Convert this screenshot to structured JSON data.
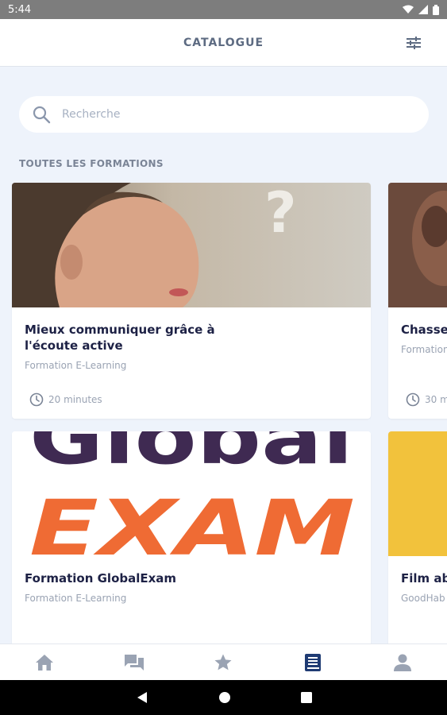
{
  "status_bar": {
    "time": "5:44"
  },
  "header": {
    "title": "CATALOGUE",
    "filter_icon": "tune-icon"
  },
  "search": {
    "placeholder": "Recherche",
    "value": ""
  },
  "section": {
    "title": "TOUTES LES FORMATIONS"
  },
  "courses": [
    {
      "title": "Mieux communiquer grâce à\nl'écoute active",
      "subtitle": "Formation E-Learning",
      "duration": "20 minutes"
    },
    {
      "title": "Chasse",
      "subtitle": "Formation",
      "duration": "30 m"
    },
    {
      "title": "Formation GlobalExam",
      "subtitle": "Formation E-Learning",
      "image_text": [
        "Global",
        "EXAM"
      ]
    },
    {
      "title": "Film ab",
      "subtitle": "GoodHab"
    }
  ],
  "bottom_nav": [
    {
      "name": "home",
      "icon": "home-icon",
      "active": false
    },
    {
      "name": "chat",
      "icon": "chat-icon",
      "active": false
    },
    {
      "name": "favorites",
      "icon": "star-icon",
      "active": false
    },
    {
      "name": "catalogue",
      "icon": "book-icon",
      "active": true
    },
    {
      "name": "profile",
      "icon": "person-icon",
      "active": false
    }
  ],
  "colors": {
    "accent": "#1f3b73",
    "inactive": "#9aa3b3",
    "background": "#eef3fb",
    "globalexam_purple": "#3f2a52",
    "globalexam_orange": "#ef6b34",
    "yellow": "#f2c23c"
  }
}
